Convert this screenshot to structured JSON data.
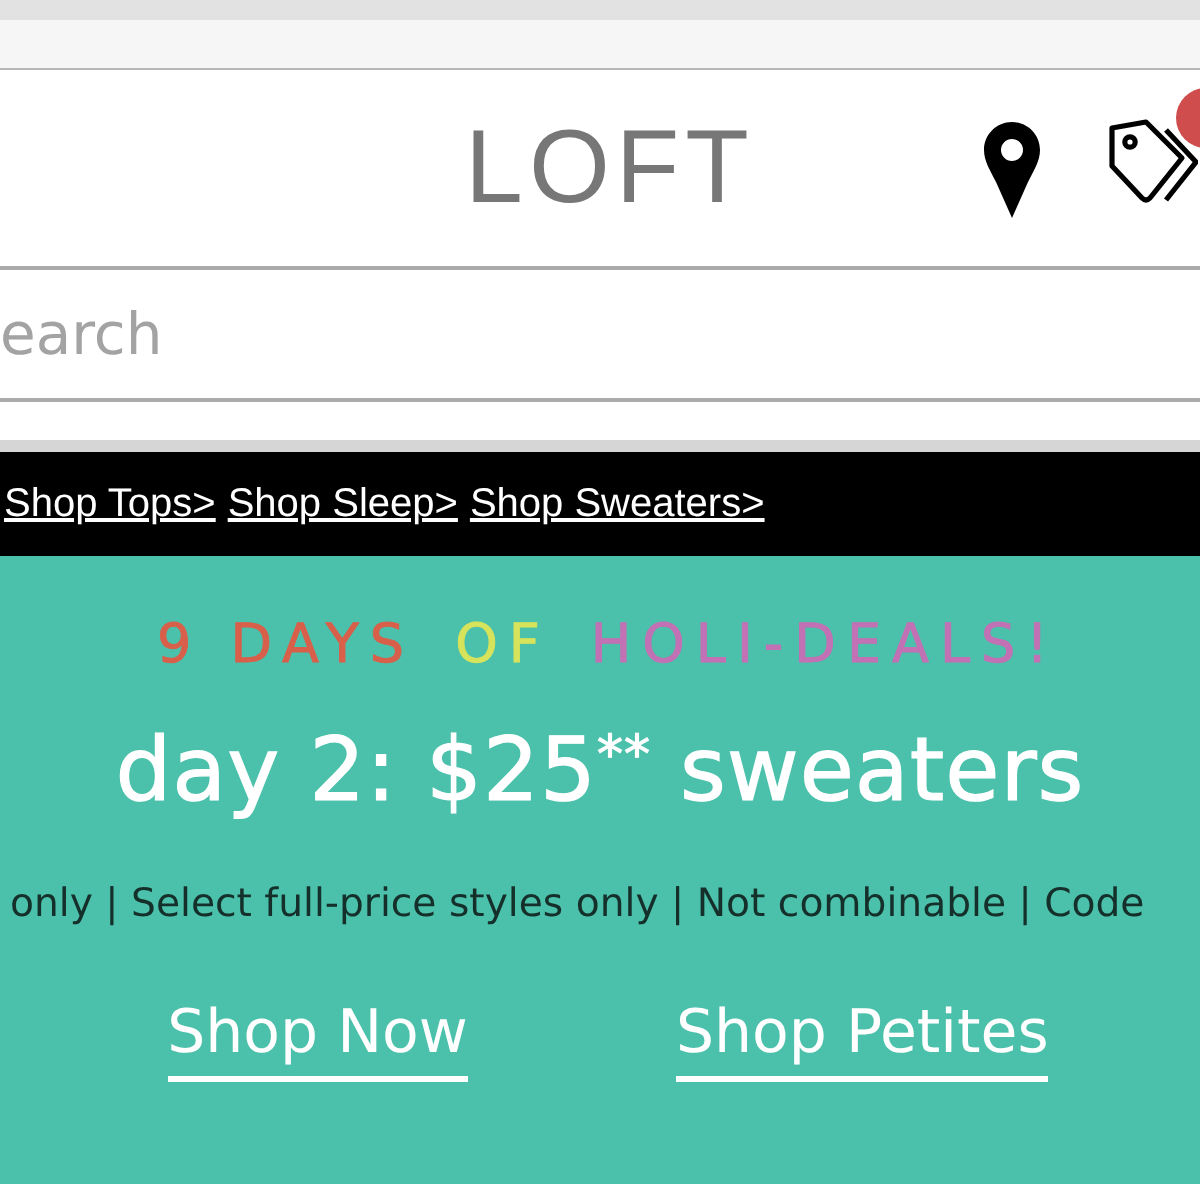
{
  "header": {
    "logo": "LOFT"
  },
  "search": {
    "placeholder": "earch"
  },
  "category_links": [
    {
      "label": "Shop Tops>"
    },
    {
      "label": "Shop Sleep>"
    },
    {
      "label": "Shop Sweaters>"
    }
  ],
  "promo": {
    "headline": [
      {
        "text": "9 DAYS",
        "color": "#d8604b"
      },
      {
        "text": "OF",
        "color": "#d6e35b"
      },
      {
        "text": "HOLI-DEALS!",
        "color": "#c271b4"
      }
    ],
    "offer": "day 2: $25$^{**}$ sweaters",
    "fine_print": "only | Select full-price styles only | Not combinable | Code",
    "buttons": [
      {
        "label": "Shop Now"
      },
      {
        "label": "Shop Petites"
      }
    ]
  }
}
